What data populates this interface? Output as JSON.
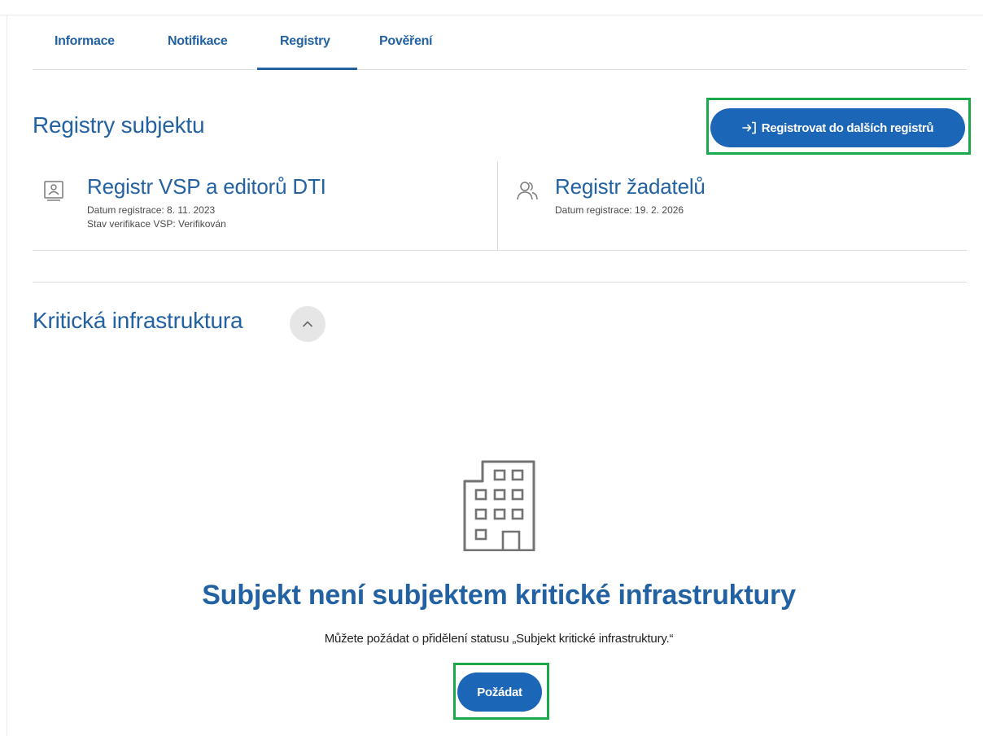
{
  "tabs": {
    "informace": "Informace",
    "notifikace": "Notifikace",
    "registry": "Registry",
    "povereni": "Pověření",
    "active": "Registry"
  },
  "registry_section": {
    "title": "Registry subjektu",
    "register_button": "Registrovat do dalších registrů",
    "register_button_icon": "login-arrow-icon"
  },
  "cards": [
    {
      "icon": "id-card-icon",
      "title": "Registr VSP a editorů DTI",
      "lines": [
        "Datum registrace: 8. 11. 2023",
        "Stav verifikace VSP: Verifikován"
      ]
    },
    {
      "icon": "users-icon",
      "title": "Registr žadatelů",
      "lines": [
        "Datum registrace: 19. 2. 2026"
      ]
    }
  ],
  "critical_section": {
    "title": "Kritická infrastruktura",
    "toggle_icon": "chevron-up-icon",
    "empty_icon": "building-icon",
    "empty_title": "Subjekt není subjektem kritické infrastruktury",
    "empty_description": "Můžete požádat o přidělení statusu „Subjekt kritické infrastruktury.“",
    "request_button": "Požádat"
  },
  "colors": {
    "primary": "#1c66b8",
    "heading": "#2362a2",
    "highlight": "#19a84a"
  }
}
